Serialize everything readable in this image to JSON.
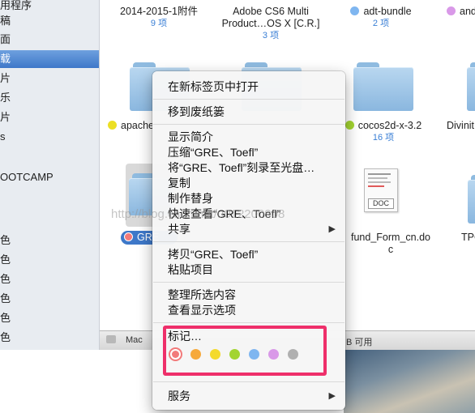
{
  "sidebar": {
    "items": [
      {
        "label": "用程序"
      },
      {
        "label": "稿"
      },
      {
        "label": "面"
      },
      {
        "label": "载",
        "selected": true
      },
      {
        "label": "片"
      },
      {
        "label": "乐"
      },
      {
        "label": "片"
      },
      {
        "label": "s"
      },
      {
        "label": "OOTCAMP"
      },
      {
        "label": "色"
      },
      {
        "label": "色"
      },
      {
        "label": "色"
      },
      {
        "label": "色"
      },
      {
        "label": "色"
      },
      {
        "label": "色"
      }
    ]
  },
  "files": {
    "row1": [
      {
        "name": "2014-2015-1附件",
        "sub": "9 项"
      },
      {
        "name1": "Adobe CS6 Multi",
        "name2": "Product…OS X [C.R.]",
        "sub": "3 项"
      },
      {
        "name": "adt-bundle",
        "sub": "2 项",
        "tag": "#7fb6f0"
      },
      {
        "name": "and",
        "tag": "#d999e8"
      }
    ],
    "row2": [
      {
        "name": "apache",
        "tag": "#ecdf24"
      },
      {
        "name": "cocos2d-x-3.2",
        "sub": "16 项",
        "tag": "#a3d431"
      },
      {
        "name": "Divinit"
      }
    ],
    "row3": [
      {
        "name": "GRE",
        "tag": "#f27a7a"
      },
      {
        "name1": "fund_Form_cn.do",
        "name2": "c",
        "doc_label": "DOC"
      },
      {
        "name": "TPC"
      }
    ]
  },
  "pathbar": {
    "root": "Mac",
    "status": "B 可用"
  },
  "menu": {
    "open_new_tab": "在新标签页中打开",
    "move_to_trash": "移到废纸篓",
    "get_info": "显示简介",
    "compress": "压缩“GRE、Toefl”",
    "burn": "将“GRE、Toefl”刻录至光盘…",
    "copy": "复制",
    "make_alias": "制作替身",
    "quick_look": "快速查看“GRE、Toefl”",
    "share": "共享",
    "copy_items": "拷贝“GRE、Toefl”",
    "paste": "粘贴项目",
    "clean_up": "整理所选内容",
    "show_view_options": "查看显示选项",
    "tags": "标记…",
    "services": "服务",
    "tag_colors": [
      "#f27a7a",
      "#f6a93b",
      "#f4da2c",
      "#a3d431",
      "#7fb6f0",
      "#d999e8",
      "#b0b0b0"
    ]
  },
  "watermark": "http://blog.csdn.net/u012200908"
}
